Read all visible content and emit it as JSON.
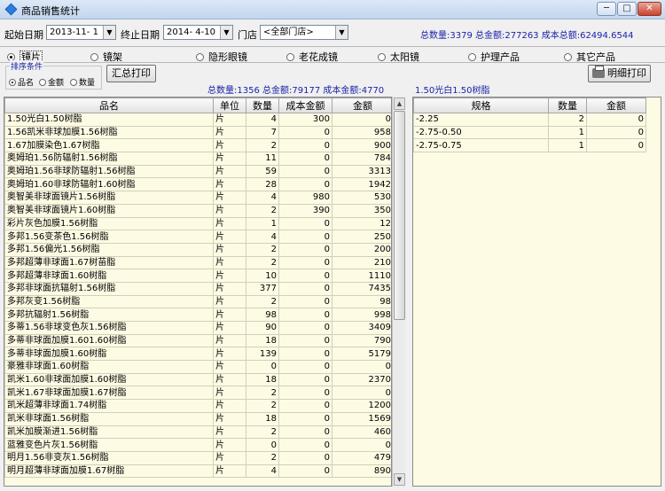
{
  "window": {
    "title": "商品销售统计",
    "min": "─",
    "max": "□",
    "close": "✕"
  },
  "filters": {
    "start_label": "起始日期",
    "start_value": "2013-11- 1",
    "end_label": "终止日期",
    "end_value": "2014- 4-10",
    "store_label": "门店",
    "store_value": "<全部门店>"
  },
  "totals": {
    "text": "总数量:3379  总金额:277263  成本总额:62494.6544"
  },
  "categories": [
    "镜片",
    "镜架",
    "隐形眼镜",
    "老花成镜",
    "太阳镜",
    "护理产品",
    "其它产品"
  ],
  "selected_category": "镜片",
  "sort": {
    "title": "排序条件",
    "options": [
      "品名",
      "金额",
      "数量"
    ],
    "selected": "品名"
  },
  "buttons": {
    "summary_print": "汇总打印",
    "detail_print": "明细打印"
  },
  "summary_stats": "总数量:1356  总金额:79177 成本金额:4770",
  "detail_title": "1.50光白1.50树脂",
  "left_table": {
    "columns": [
      "品名",
      "单位",
      "数量",
      "成本金额",
      "金额"
    ],
    "rows": [
      [
        "1.50光白1.50树脂",
        "片",
        "4",
        "300",
        "0"
      ],
      [
        "1.56凯米非球加膜1.56树脂",
        "片",
        "7",
        "0",
        "958"
      ],
      [
        "1.67加膜染色1.67树脂",
        "片",
        "2",
        "0",
        "900"
      ],
      [
        "奥姆珀1.56防辐射1.56树脂",
        "片",
        "11",
        "0",
        "784"
      ],
      [
        "奥姆珀1.56非球防辐射1.56树脂",
        "片",
        "59",
        "0",
        "3313"
      ],
      [
        "奥姆珀1.60非球防辐射1.60树脂",
        "片",
        "28",
        "0",
        "1942"
      ],
      [
        "奥智美非球面镜片1.56树脂",
        "片",
        "4",
        "980",
        "530"
      ],
      [
        "奥智美非球面镜片1.60树脂",
        "片",
        "2",
        "390",
        "350"
      ],
      [
        "彩片灰色加膜1.56树脂",
        "片",
        "1",
        "0",
        "12"
      ],
      [
        "多邦1.56变茶色1.56树脂",
        "片",
        "4",
        "0",
        "250"
      ],
      [
        "多邦1.56偏光1.56树脂",
        "片",
        "2",
        "0",
        "200"
      ],
      [
        "多邦超薄非球面1.67树苗脂",
        "片",
        "2",
        "0",
        "210"
      ],
      [
        "多邦超薄非球面1.60树脂",
        "片",
        "10",
        "0",
        "1110"
      ],
      [
        "多邦非球面抗辐射1.56树脂",
        "片",
        "377",
        "0",
        "7435"
      ],
      [
        "多邦灰变1.56树脂",
        "片",
        "2",
        "0",
        "98"
      ],
      [
        "多邦抗辐射1.56树脂",
        "片",
        "98",
        "0",
        "998"
      ],
      [
        "多蒂1.56非球变色灰1.56树脂",
        "片",
        "90",
        "0",
        "3409"
      ],
      [
        "多蒂非球面加膜1.601.60树脂",
        "片",
        "18",
        "0",
        "790"
      ],
      [
        "多蒂非球面加膜1.60树脂",
        "片",
        "139",
        "0",
        "5179"
      ],
      [
        "豪雅非球面1.60树脂",
        "片",
        "0",
        "0",
        "0"
      ],
      [
        "凯米1.60非球面加膜1.60树脂",
        "片",
        "18",
        "0",
        "2370"
      ],
      [
        "凯米1.67非球面加膜1.67树脂",
        "片",
        "2",
        "0",
        "0"
      ],
      [
        "凯米超薄非球面1.74树脂",
        "片",
        "2",
        "0",
        "1200"
      ],
      [
        "凯米非球面1.56树脂",
        "片",
        "18",
        "0",
        "1569"
      ],
      [
        "凯米加膜渐进1.56树脂",
        "片",
        "2",
        "0",
        "460"
      ],
      [
        "蓝雅变色片灰1.56树脂",
        "片",
        "0",
        "0",
        "0"
      ],
      [
        "明月1.56非变灰1.56树脂",
        "片",
        "2",
        "0",
        "479"
      ],
      [
        "明月超薄非球面加膜1.67树脂",
        "片",
        "4",
        "0",
        "890"
      ]
    ]
  },
  "right_table": {
    "columns": [
      "规格",
      "数量",
      "金额"
    ],
    "rows": [
      [
        "-2.25",
        "2",
        "0"
      ],
      [
        "-2.75-0.50",
        "1",
        "0"
      ],
      [
        "-2.75-0.75",
        "1",
        "0"
      ]
    ]
  },
  "scrollbar": {
    "up": "▲",
    "down": "▼"
  }
}
